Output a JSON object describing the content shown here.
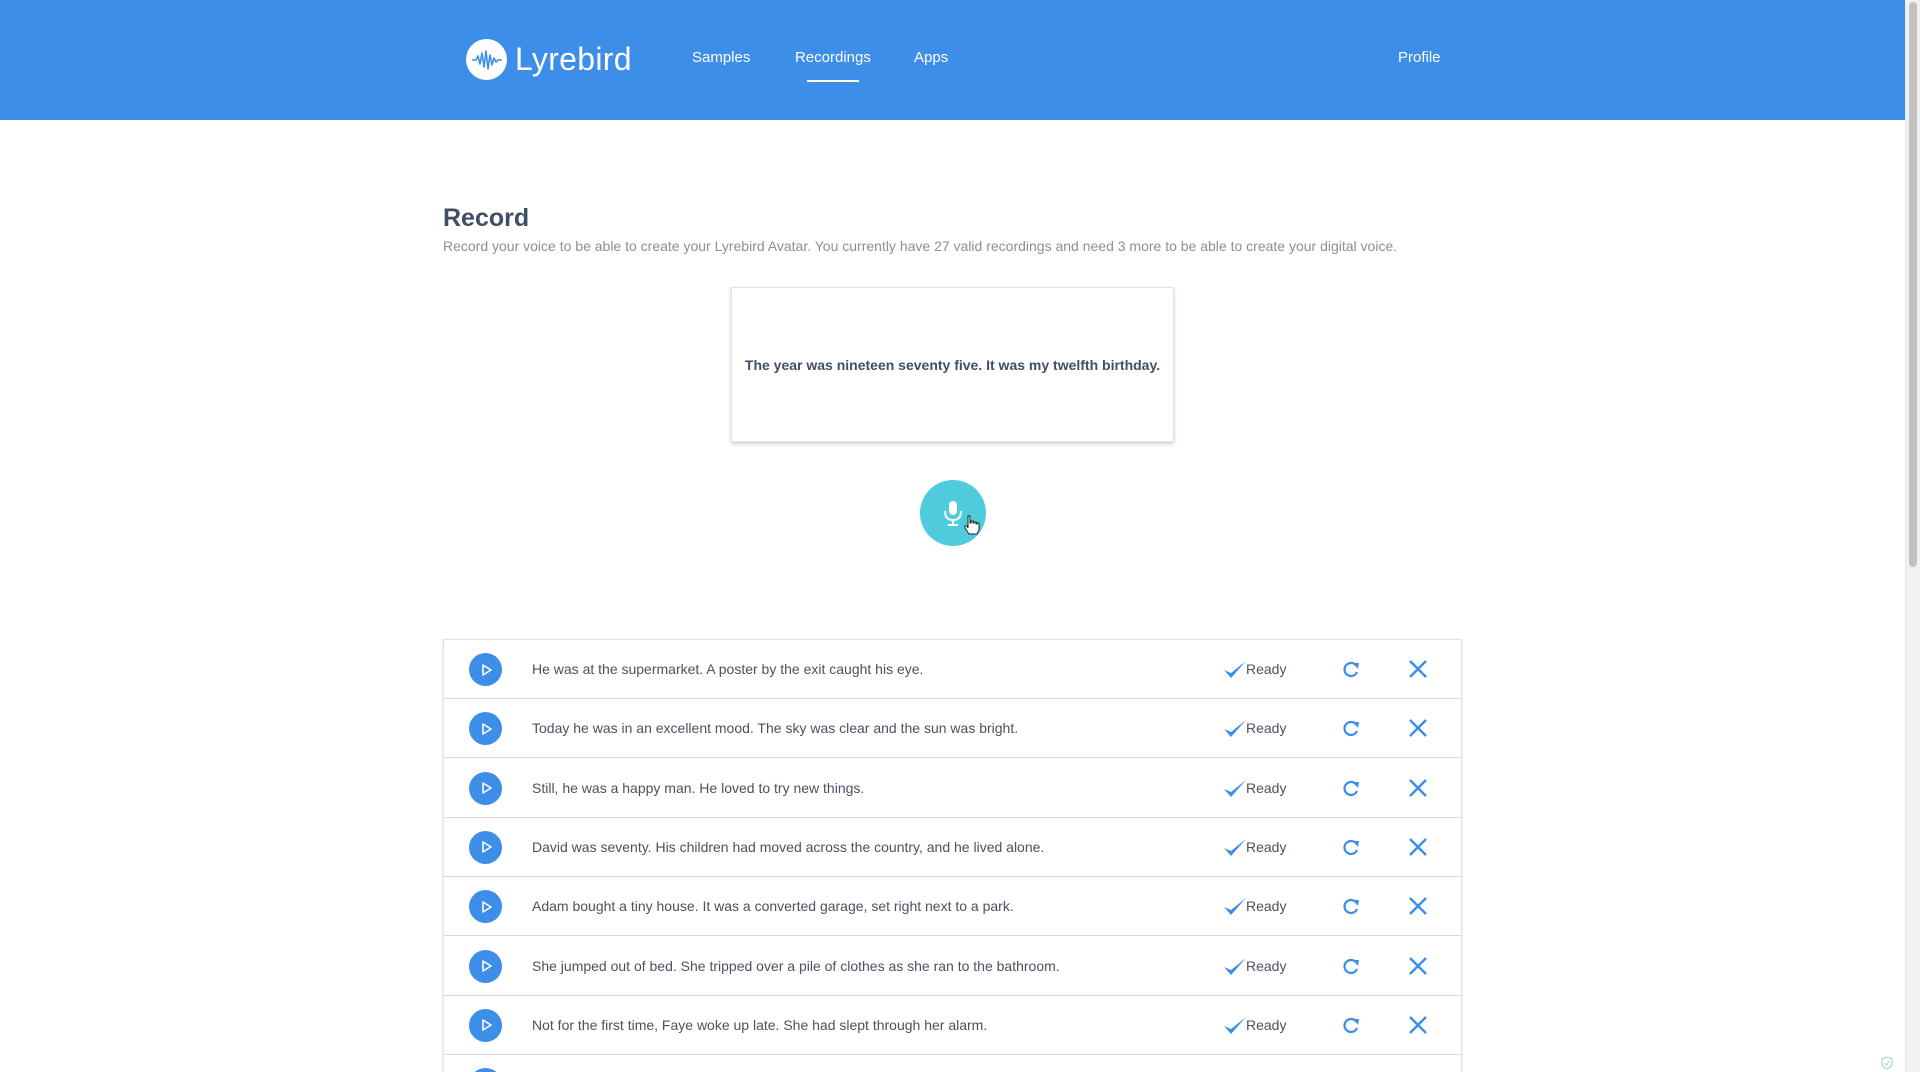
{
  "brand": {
    "name": "Lyrebird"
  },
  "nav": {
    "samples": "Samples",
    "recordings": "Recordings",
    "apps": "Apps",
    "profile": "Profile"
  },
  "record": {
    "title": "Record",
    "description": "Record your voice to be able to create your Lyrebird Avatar. You currently have 27 valid recordings and need 3 more to be able to create your digital voice.",
    "prompt": "The year was nineteen seventy five. It was my twelfth birthday."
  },
  "recordings": [
    {
      "text": "He was at the supermarket. A poster by the exit caught his eye.",
      "status": "Ready"
    },
    {
      "text": "Today he was in an excellent mood. The sky was clear and the sun was bright.",
      "status": "Ready"
    },
    {
      "text": "Still, he was a happy man. He loved to try new things.",
      "status": "Ready"
    },
    {
      "text": "David was seventy. His children had moved across the country, and he lived alone.",
      "status": "Ready"
    },
    {
      "text": "Adam bought a tiny house. It was a converted garage, set right next to a park.",
      "status": "Ready"
    },
    {
      "text": "She jumped out of bed. She tripped over a pile of clothes as she ran to the bathroom.",
      "status": "Ready"
    },
    {
      "text": "Not for the first time, Faye woke up late. She had slept through her alarm.",
      "status": "Ready"
    }
  ],
  "colors": {
    "header": "#3d8ee8",
    "mic": "#4fcbde",
    "accent": "#3d8ee8",
    "title": "#3f4f67"
  }
}
